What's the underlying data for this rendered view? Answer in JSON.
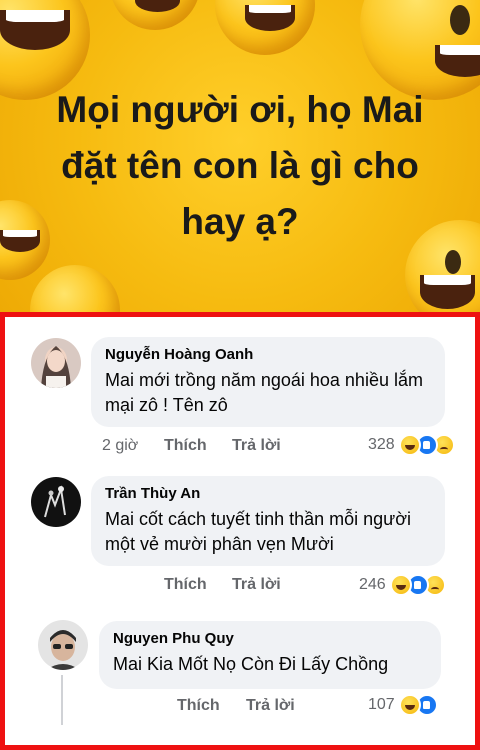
{
  "poster": {
    "title": "Mọi người ơi, họ Mai đặt tên con là gì cho hay ạ?",
    "background_color": "#f6bb10"
  },
  "comments": [
    {
      "author": "Nguyễn Hoàng Oanh",
      "text": "Mai mới trồng năm ngoái hoa nhiều lắm mại zô ! Tên zô",
      "time": "2 giờ",
      "like_label": "Thích",
      "reply_label": "Trả lời",
      "reaction_count": "328",
      "reactions": [
        "haha-icon",
        "like-icon",
        "sad-icon"
      ]
    },
    {
      "author": "Trần Thùy An",
      "text": "Mai cốt cách tuyết tinh thần mỗi người một vẻ mười phân vẹn Mười",
      "like_label": "Thích",
      "reply_label": "Trả lời",
      "reaction_count": "246",
      "reactions": [
        "haha-icon",
        "like-icon",
        "sad-icon"
      ]
    },
    {
      "author": "Nguyen Phu Quy",
      "text": "Mai Kia Mốt Nọ Còn Đi Lấy Chồng",
      "like_label": "Thích",
      "reply_label": "Trả lời",
      "reaction_count": "107",
      "reactions": [
        "haha-icon",
        "like-icon"
      ]
    }
  ],
  "highlight_border_color": "#ee1111"
}
